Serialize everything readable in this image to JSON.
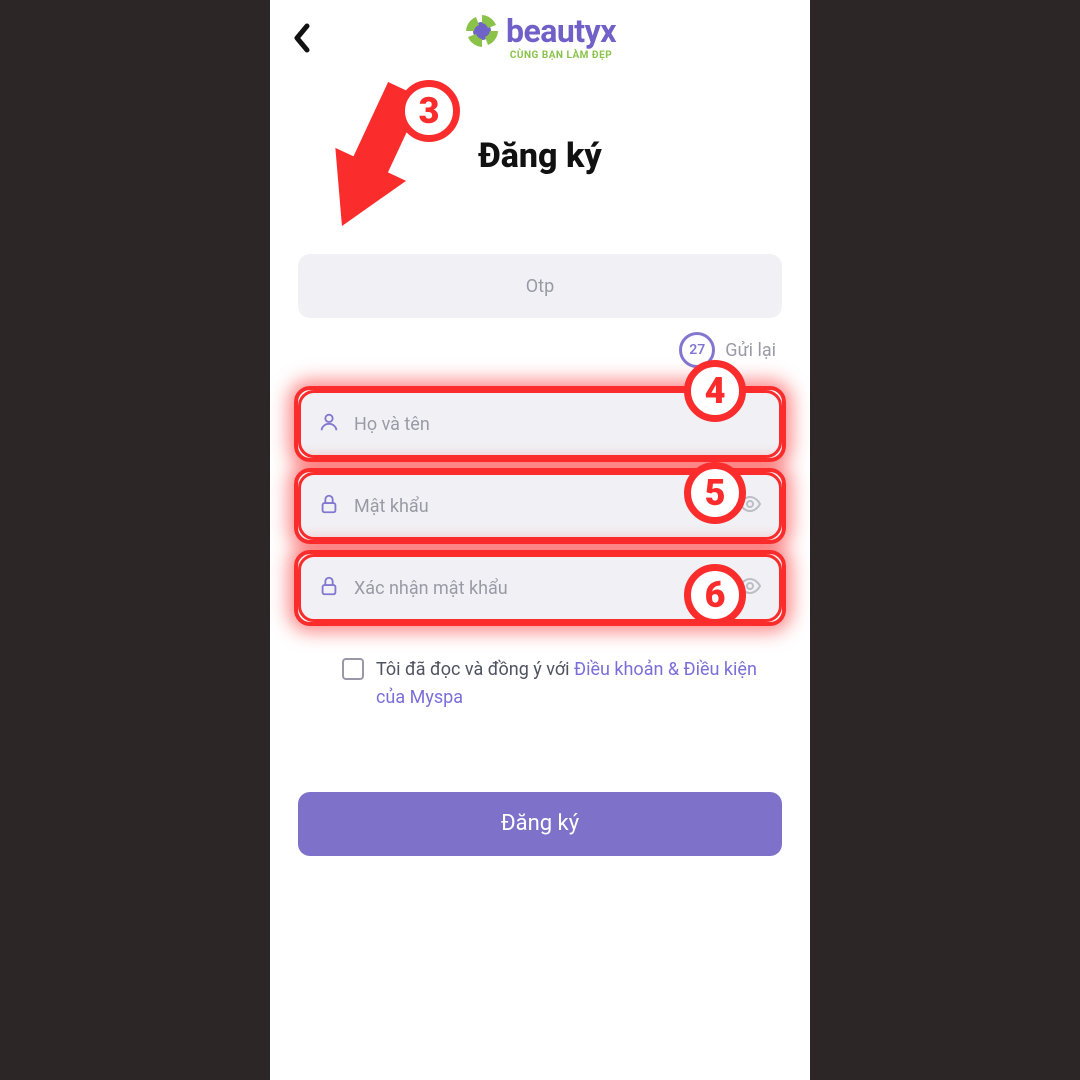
{
  "logo": {
    "word_a": "beauty",
    "word_b": "x",
    "tagline": "CÙNG BẠN LÀM ĐẸP"
  },
  "title": "Đăng ký",
  "otp": {
    "placeholder": "Otp",
    "countdown": "27",
    "resend": "Gửi lại"
  },
  "name": {
    "placeholder": "Họ và tên"
  },
  "password": {
    "placeholder": "Mật khẩu"
  },
  "confirm": {
    "placeholder": "Xác nhận mật khẩu"
  },
  "terms": {
    "pre": "Tôi đã đọc và đồng ý với ",
    "link": "Điều khoản & Điều kiện của Myspa"
  },
  "submit": "Đăng ký",
  "annotations": {
    "n3": "3",
    "n4": "4",
    "n5": "5",
    "n6": "6"
  }
}
